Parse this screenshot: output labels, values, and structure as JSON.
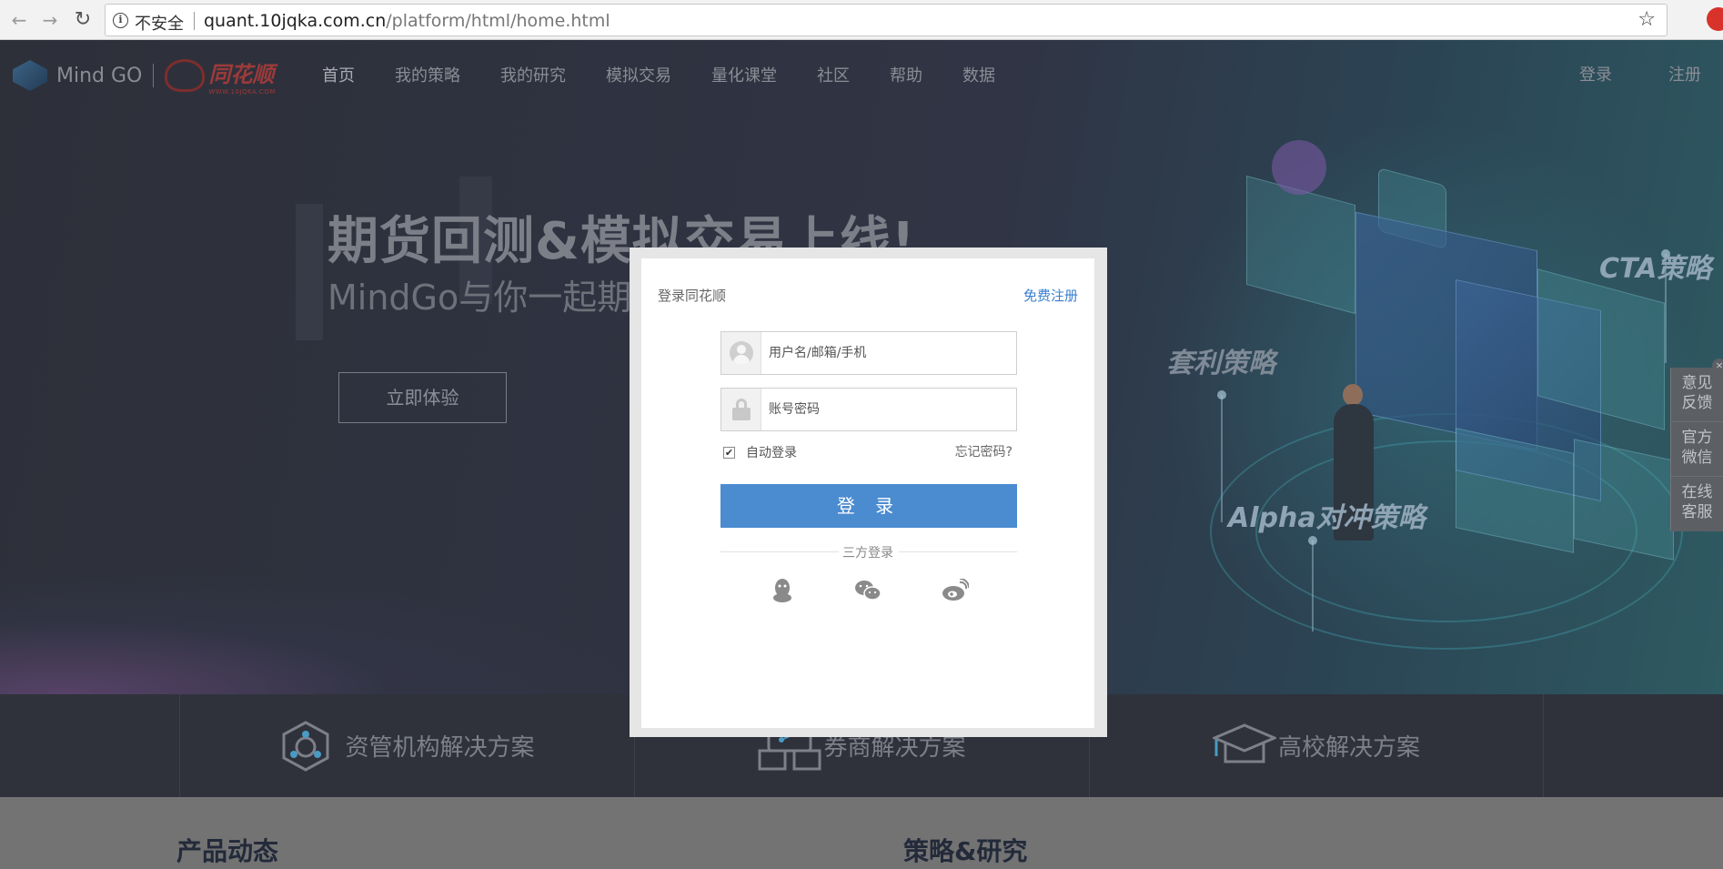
{
  "browser": {
    "insecure_label": "不安全",
    "url_host": "quant.10jqka.com.cn",
    "url_path": "/platform/html/home.html"
  },
  "header": {
    "logo_text": "Mind GO",
    "partner_logo": "同花顺",
    "partner_sub": "WWW.10JQKA.COM",
    "nav": [
      "首页",
      "我的策略",
      "我的研究",
      "模拟交易",
      "量化课堂",
      "社区",
      "帮助",
      "数据"
    ],
    "login": "登录",
    "register": "注册"
  },
  "hero": {
    "headline": "期货回测&模拟交易上线!",
    "subline": "MindGo与你一起期货",
    "cta": "立即体验",
    "labels": {
      "cta_strategy": "CTA策略",
      "arbitrage": "套利策略",
      "alpha": "Alpha对冲策略"
    }
  },
  "side_widget": {
    "items": [
      "意见\n反馈",
      "官方\n微信",
      "在线\n客服"
    ]
  },
  "solutions": [
    "资管机构解决方案",
    "券商解决方案",
    "高校解决方案"
  ],
  "lower": {
    "left_title": "产品动态",
    "right_title": "策略&研究"
  },
  "login_modal": {
    "title": "登录同花顺",
    "register_link": "免费注册",
    "username_placeholder": "用户名/邮箱/手机",
    "password_placeholder": "账号密码",
    "auto_login": "自动登录",
    "auto_login_checked": true,
    "forgot": "忘记密码?",
    "submit": "登 录",
    "third_party": "三方登录",
    "social": [
      "qq-icon",
      "wechat-icon",
      "weibo-icon"
    ]
  },
  "colors": {
    "accent": "#4b8bd0",
    "link": "#3a7fcf"
  }
}
